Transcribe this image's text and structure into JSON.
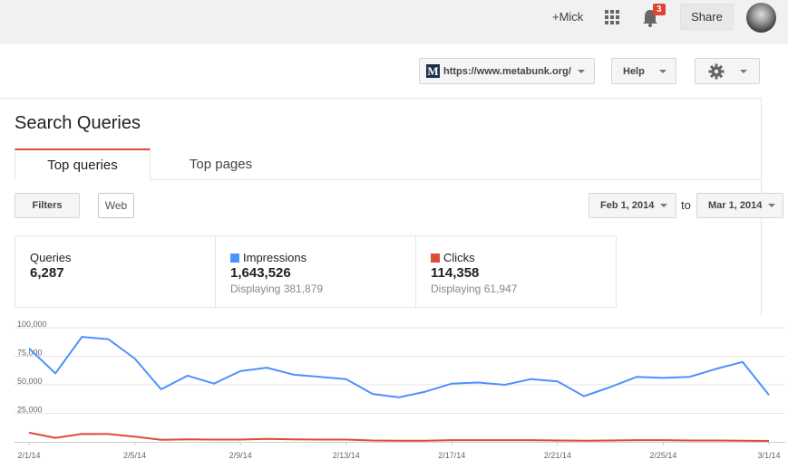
{
  "topbar": {
    "user": "+Mick",
    "apps_icon": "apps-grid-icon",
    "notifications_icon": "bell-icon",
    "notification_count": "3",
    "share": "Share"
  },
  "toolbar": {
    "site_logo": "M",
    "site_url": "https://www.metabunk.org/",
    "help": "Help",
    "settings_icon": "gear-icon"
  },
  "page": {
    "title": "Search Queries",
    "tabs": [
      {
        "label": "Top queries",
        "active": true
      },
      {
        "label": "Top pages",
        "active": false
      }
    ]
  },
  "controls": {
    "filters": "Filters",
    "web": "Web",
    "date_from": "Feb 1, 2014",
    "to": "to",
    "date_to": "Mar 1, 2014"
  },
  "stats": {
    "queries": {
      "label": "Queries",
      "value": "6,287"
    },
    "impressions": {
      "label": "Impressions",
      "value": "1,643,526",
      "sub": "Displaying 381,879",
      "color": "#4d90fe"
    },
    "clicks": {
      "label": "Clicks",
      "value": "114,358",
      "sub": "Displaying 61,947",
      "color": "#dd4b39"
    }
  },
  "chart_data": {
    "type": "line",
    "x": [
      "2/1/14",
      "2/2/14",
      "2/3/14",
      "2/4/14",
      "2/5/14",
      "2/6/14",
      "2/7/14",
      "2/8/14",
      "2/9/14",
      "2/10/14",
      "2/11/14",
      "2/12/14",
      "2/13/14",
      "2/14/14",
      "2/15/14",
      "2/16/14",
      "2/17/14",
      "2/18/14",
      "2/19/14",
      "2/20/14",
      "2/21/14",
      "2/22/14",
      "2/23/14",
      "2/24/14",
      "2/25/14",
      "2/26/14",
      "2/27/14",
      "2/28/14",
      "3/1/14"
    ],
    "x_tick_labels": [
      "2/1/14",
      "2/5/14",
      "2/9/14",
      "2/13/14",
      "2/17/14",
      "2/21/14",
      "2/25/14",
      "3/1/14"
    ],
    "y_ticks": [
      "100,000",
      "75,000",
      "50,000",
      "25,000"
    ],
    "ylim": [
      0,
      100000
    ],
    "series": [
      {
        "name": "Impressions",
        "color": "#4d90fe",
        "values": [
          82000,
          60000,
          92000,
          90000,
          73000,
          46000,
          58000,
          51000,
          62000,
          65000,
          59000,
          57000,
          55000,
          42000,
          39000,
          44000,
          51000,
          52000,
          50000,
          55000,
          53000,
          40000,
          48000,
          57000,
          56000,
          57000,
          64000,
          70000,
          41000
        ]
      },
      {
        "name": "Clicks",
        "color": "#dd4b39",
        "values": [
          8000,
          3500,
          7000,
          6800,
          4500,
          1800,
          2200,
          2000,
          2000,
          2500,
          2200,
          2000,
          2000,
          1200,
          1000,
          1000,
          1500,
          1500,
          1500,
          1500,
          1200,
          1000,
          1200,
          1500,
          1500,
          1200,
          1200,
          1000,
          800
        ]
      }
    ]
  }
}
